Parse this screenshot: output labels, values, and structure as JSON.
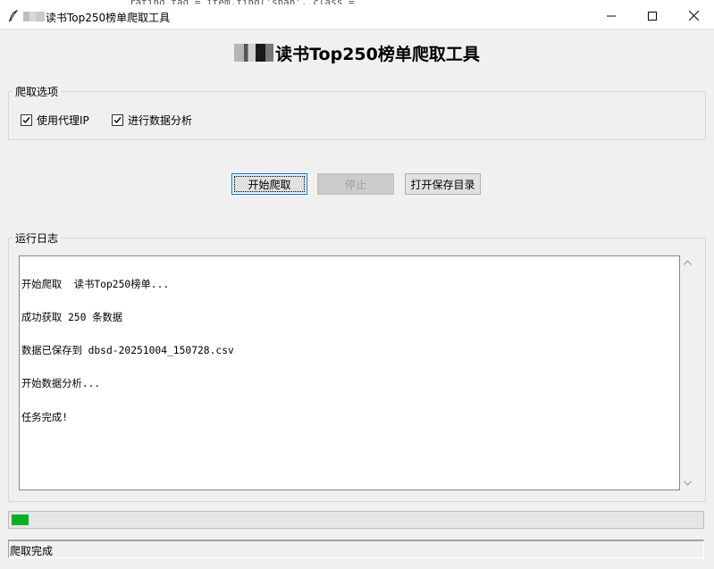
{
  "window": {
    "title": "读书Top250榜单爬取工具",
    "background_code": "rating_tag = item.find('span', class_="
  },
  "header": {
    "title": "读书Top250榜单爬取工具"
  },
  "options": {
    "legend": "爬取选项",
    "use_proxy": {
      "label": "使用代理IP",
      "checked": true
    },
    "analyze": {
      "label": "进行数据分析",
      "checked": true
    }
  },
  "buttons": {
    "start": "开始爬取",
    "stop": "停止",
    "open_dir": "打开保存目录"
  },
  "log": {
    "legend": "运行日志",
    "lines": [
      "开始爬取  读书Top250榜单...",
      "成功获取 250 条数据",
      "数据已保存到 dbsd-20251004_150728.csv",
      "开始数据分析...",
      "任务完成!"
    ]
  },
  "progress": {
    "value": 0.025,
    "color": "#06b025"
  },
  "status": {
    "text": "爬取完成"
  },
  "colors": {
    "focus_border": "#0078d7",
    "disabled_bg": "#cccccc"
  },
  "icons": {
    "app": "feather-icon",
    "minimize": "minimize-icon",
    "maximize": "maximize-icon",
    "close": "close-icon",
    "check": "check-icon",
    "scroll_up": "chevron-up-icon",
    "scroll_down": "chevron-down-icon"
  }
}
